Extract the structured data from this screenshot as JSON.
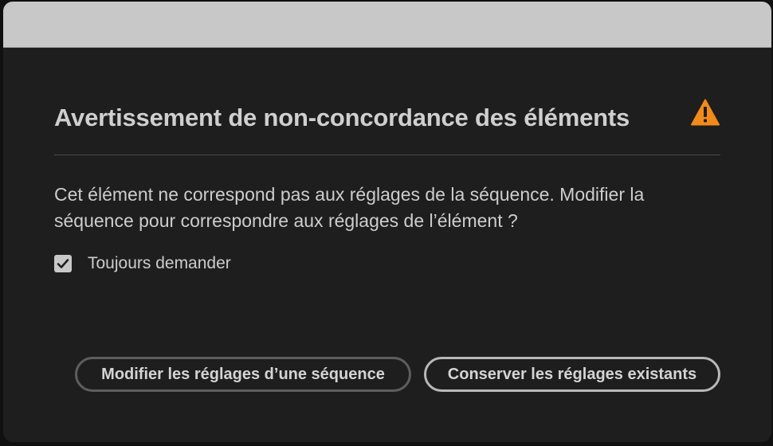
{
  "dialog": {
    "title": "Avertissement de non-concordance des éléments",
    "warning_icon": "warning-triangle-icon",
    "warning_color": "#f18a1b",
    "message": "Cet élément ne correspond pas aux réglages de la séquence. Modifier la séquence pour correspondre aux réglages de l’élément ?",
    "checkbox": {
      "label": "Toujours demander",
      "checked": true
    },
    "buttons": {
      "change_label": "Modifier les réglages d’une séquence",
      "keep_label": "Conserver les réglages existants"
    }
  }
}
